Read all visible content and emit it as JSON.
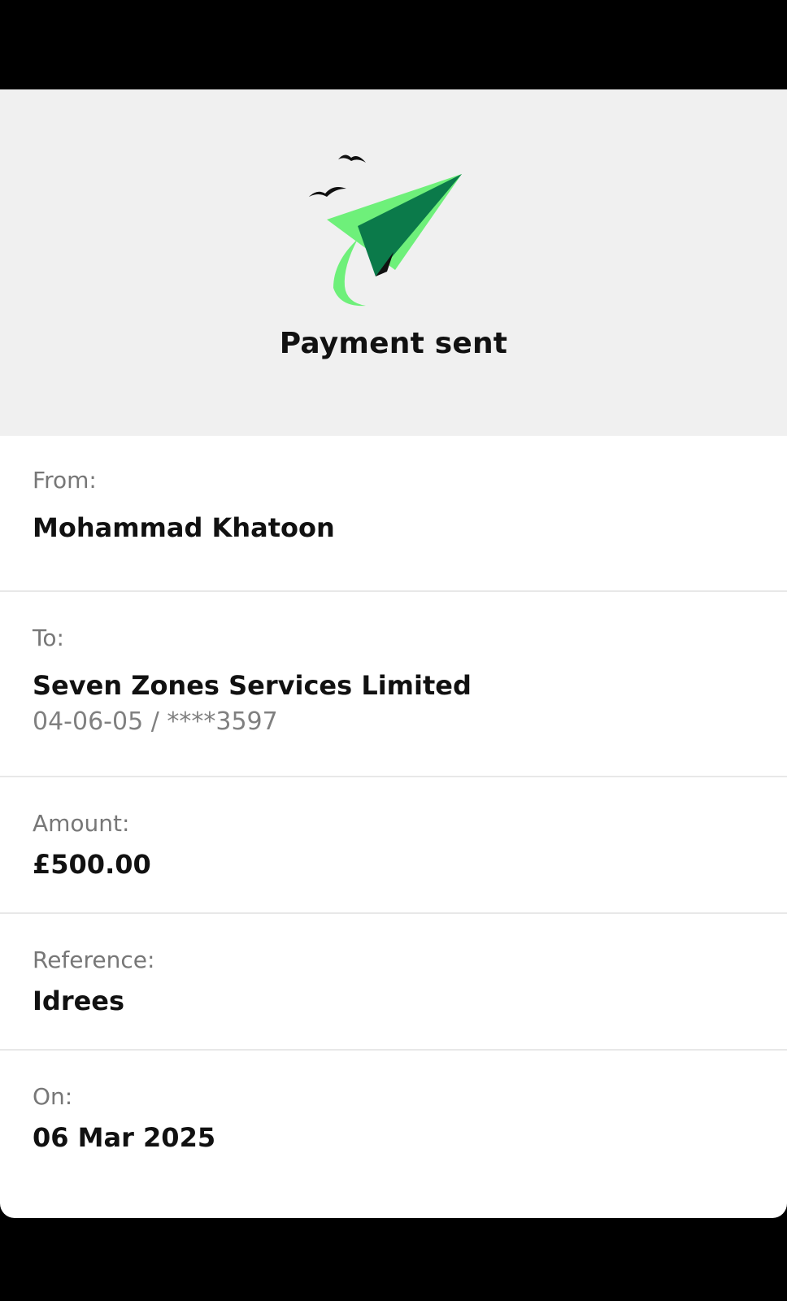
{
  "header": {
    "title": "Payment sent",
    "illustration_icon": "paper-plane-with-birds-icon",
    "accent_light": "#6ef07a",
    "accent_dark": "#0b7a4a"
  },
  "details": {
    "from": {
      "label": "From:",
      "value": "Mohammad Khatoon"
    },
    "to": {
      "label": "To:",
      "value": "Seven Zones Services Limited",
      "account": "04-06-05 / ****3597"
    },
    "amount": {
      "label": "Amount:",
      "value": "£500.00"
    },
    "reference": {
      "label": "Reference:",
      "value": "Idrees"
    },
    "date": {
      "label": "On:",
      "value": "06 Mar 2025"
    }
  }
}
